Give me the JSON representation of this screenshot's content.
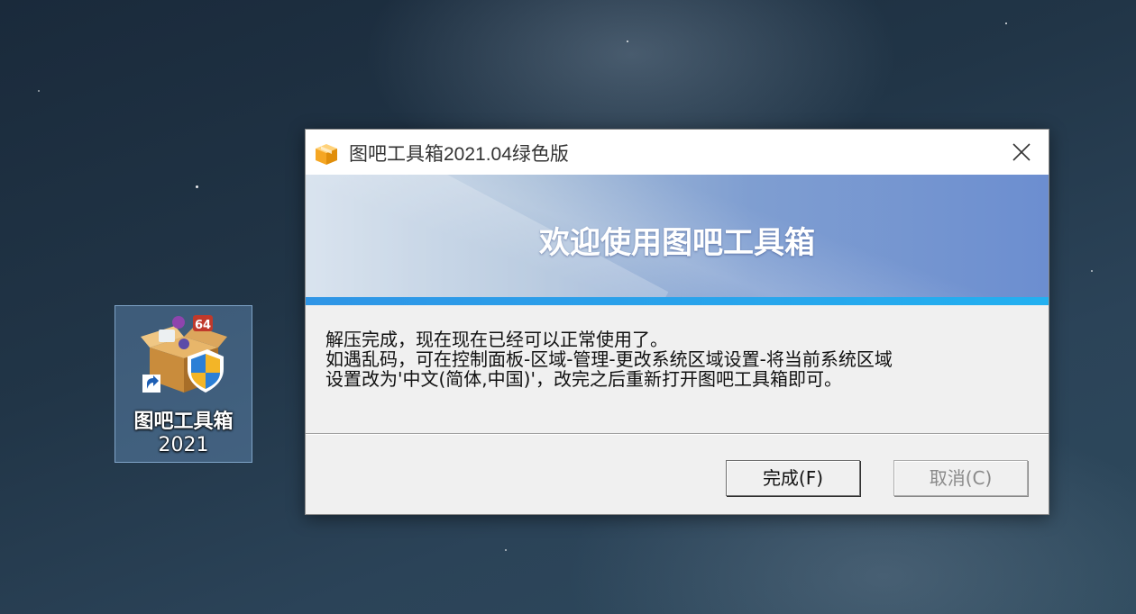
{
  "desktop": {
    "icon_label_line1": "图吧工具箱",
    "icon_label_line2": "2021"
  },
  "dialog": {
    "title": "图吧工具箱2021.04绿色版",
    "banner_title": "欢迎使用图吧工具箱",
    "message_lines": [
      "解压完成，现在现在已经可以正常使用了。",
      "如遇乱码，可在控制面板-区域-管理-更改系统区域设置-将当前系统区域",
      "设置改为'中文(简体,中国)'，改完之后重新打开图吧工具箱即可。"
    ],
    "ok_label": "完成(F)",
    "cancel_label": "取消(C)",
    "icons": [
      "app-box-icon",
      "close-icon"
    ]
  },
  "colors": {
    "banner_accent": "#23b0f0",
    "dialog_bg": "#f0f0f0"
  }
}
